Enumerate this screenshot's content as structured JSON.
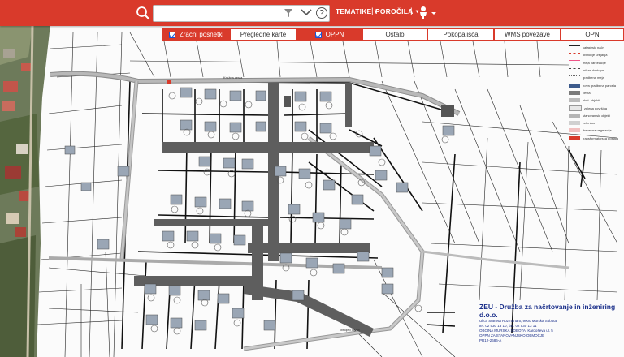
{
  "toolbar": {
    "search_placeholder": "",
    "help_label": "?",
    "menu_tematike": "TEMATIKE",
    "menu_porocila": "POROČILA",
    "separator": "|",
    "accent": "#d93a2b"
  },
  "tabs": [
    {
      "label": "Zračni posnetki",
      "active": true,
      "checked": true
    },
    {
      "label": "Pregledne karte",
      "active": false,
      "checked": false
    },
    {
      "label": "OPPN",
      "active": true,
      "checked": true
    },
    {
      "label": "Ostalo",
      "active": false,
      "checked": false
    },
    {
      "label": "Pokopališča",
      "active": false,
      "checked": false
    },
    {
      "label": "WMS povezave",
      "active": false,
      "checked": false
    },
    {
      "label": "OPN",
      "active": false,
      "checked": false
    }
  ],
  "legend": [
    "katastrski načrt",
    "območje urejanja",
    "meja parcelacije",
    "prikaz dostopa",
    "gradbena meja",
    "nova gradbena parcela",
    "cesta",
    "obst. objekti",
    "zelena površina",
    "stanovanjski objekt",
    "zelenica",
    "drevesna vegetacija",
    "transformatorska postaja"
  ],
  "map_labels": {
    "road_label": "Krožna cesta",
    "note_label": "obstoječi objekti"
  },
  "company": {
    "title": "ZEU - Družba za načrtovanje in inženiring d.o.o.",
    "line1": "Ulica Staneta Rozmana 5, 9000 Murska Sobota",
    "line2": "tel: 02 530 13 10, fax: 02 530 13 11",
    "line3": "OBČINA MURSKA SOBOTA, Kardoševa ul. 5",
    "line4": "OPPN ZA STANOVANJSKO OBMOČJE",
    "project_no": "PR12-2686-A"
  }
}
